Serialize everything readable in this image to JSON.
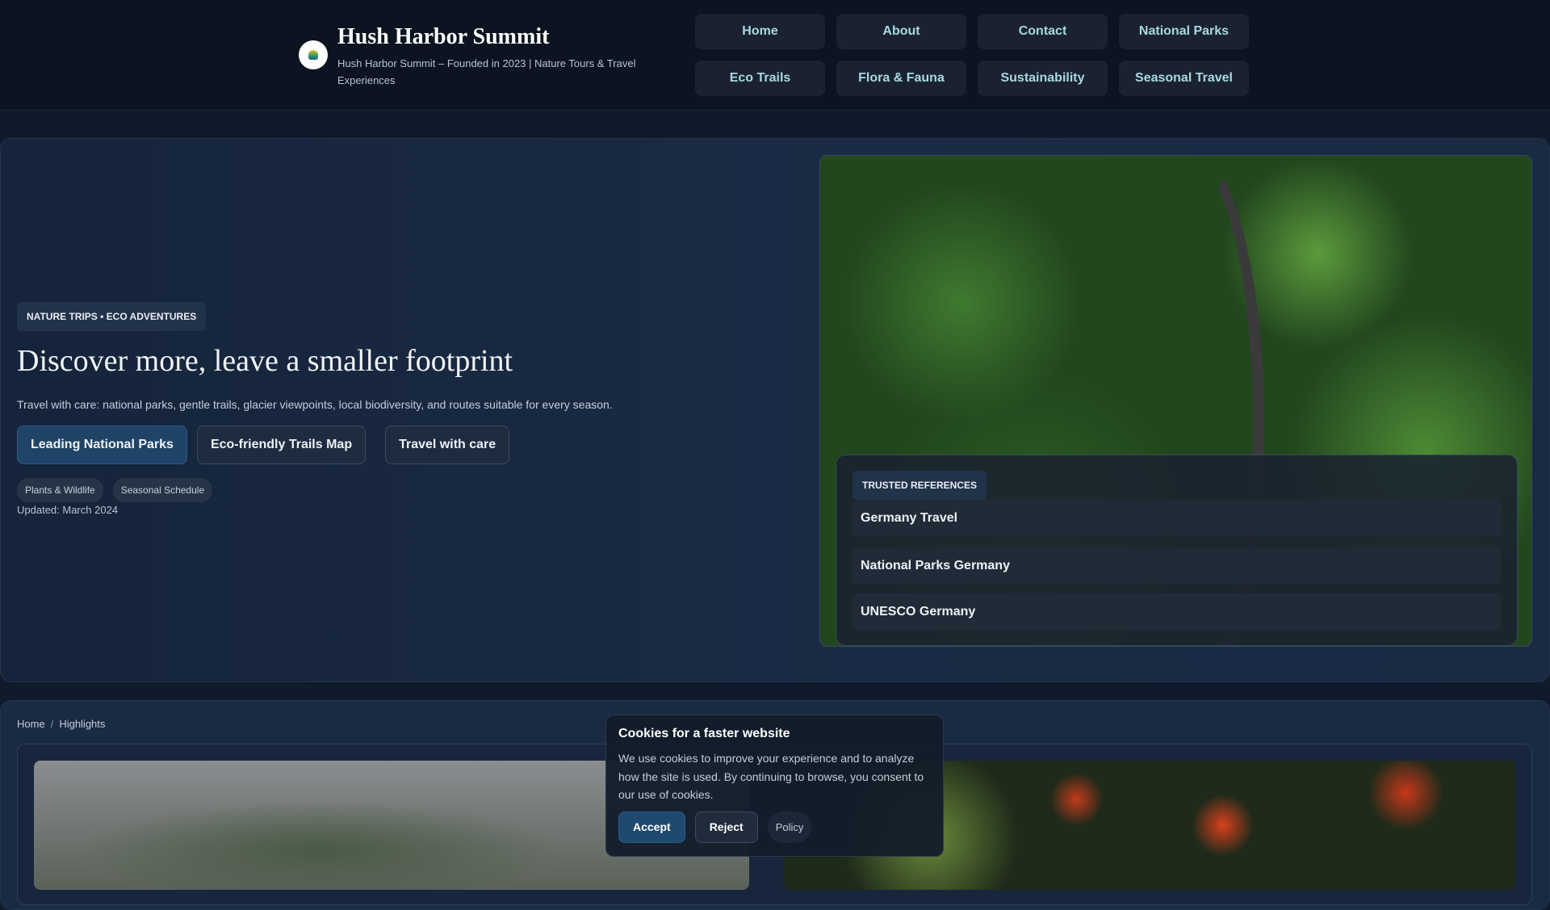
{
  "header": {
    "title": "Hush Harbor Summit",
    "subtitle": "Hush Harbor Summit – Founded in 2023 | Nature Tours & Travel Experiences",
    "nav": [
      "Home",
      "About",
      "Contact",
      "National Parks",
      "Eco Trails",
      "Flora & Fauna",
      "Sustainability",
      "Seasonal Travel"
    ]
  },
  "hero": {
    "badge": "NATURE TRIPS • ECO ADVENTURES",
    "title": "Discover more, leave a smaller footprint",
    "text": "Travel with care: national parks, gentle trails, glacier viewpoints, local biodiversity, and routes suitable for every season.",
    "buttons": [
      "Leading National Parks",
      "Eco-friendly Trails Map",
      "Travel with care"
    ],
    "tags": [
      "Plants & Wildlife",
      "Seasonal Schedule"
    ],
    "updated": "Updated: March 2024",
    "refs_badge": "TRUSTED REFERENCES",
    "refs": [
      "Germany Travel",
      "National Parks Germany",
      "UNESCO Germany"
    ]
  },
  "breadcrumb": {
    "home": "Home",
    "sep": "/",
    "current": "Highlights"
  },
  "cookie": {
    "title": "Cookies for a faster website",
    "text": "We use cookies to improve your experience and to analyze how the site is used. By continuing to browse, you consent to our use of cookies.",
    "accept": "Accept",
    "reject": "Reject",
    "policy": "Policy"
  }
}
